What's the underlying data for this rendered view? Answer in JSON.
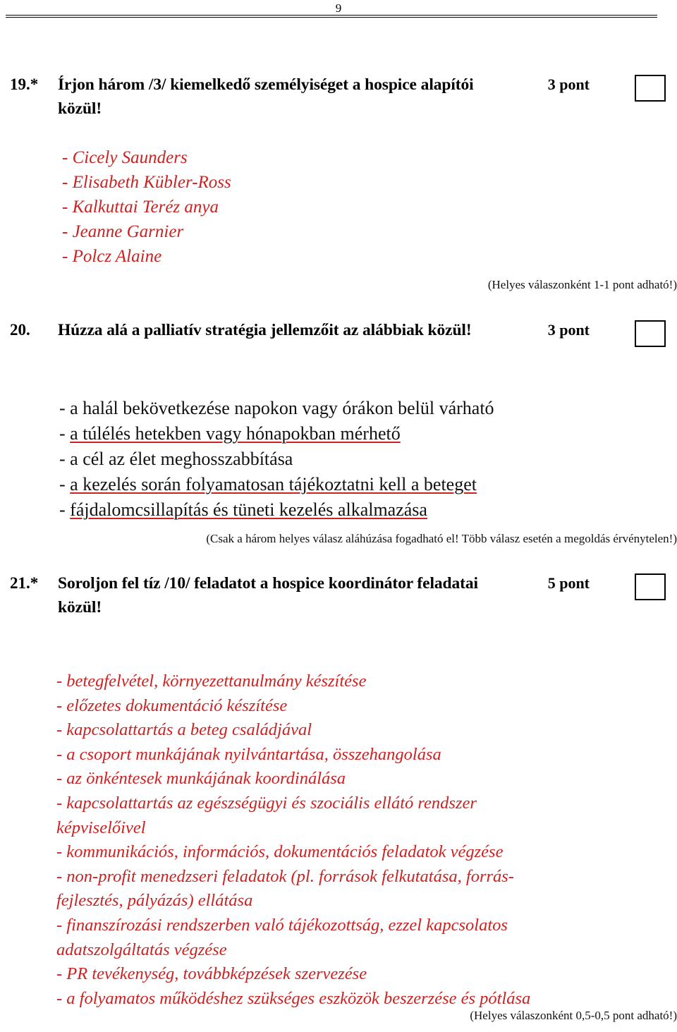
{
  "page": {
    "number": "9"
  },
  "questions": [
    {
      "id": "q19",
      "number": "19.*",
      "title": "Írjon három /3/ kiemelkedő személyiséget a hospice alapítói közül!",
      "points": "3 pont",
      "score_box_value": "",
      "answers": [
        "- Cicely Saunders",
        "- Elisabeth Kübler-Ross",
        "- Kalkuttai Teréz anya",
        "- Jeanne Garnier",
        "- Polcz Alaine"
      ],
      "note": "(Helyes válaszonként 1-1 pont adható!)"
    },
    {
      "id": "q20",
      "number": "20.",
      "title": "Húzza alá a palliatív stratégia jellemzőit az alábbiak közül!",
      "points": "3 pont",
      "score_box_value": "",
      "options": [
        {
          "text": "a halál bekövetkezése napokon vagy órákon belül várható",
          "underlined": false
        },
        {
          "text": "a túlélés hetekben vagy hónapokban mérhető",
          "underlined": true
        },
        {
          "text": "a cél az élet meghosszabbítása",
          "underlined": false
        },
        {
          "text": "a kezelés során folyamatosan tájékoztatni kell a beteget",
          "underlined": true
        },
        {
          "text": "fájdalomcsillapítás és tüneti kezelés alkalmazása",
          "underlined": true
        }
      ],
      "note": "(Csak a három helyes válasz aláhúzása fogadható el! Több válasz esetén a megoldás érvénytelen!)"
    },
    {
      "id": "q21",
      "number": "21.*",
      "title": "Soroljon fel tíz /10/ feladatot a hospice koordinátor feladatai közül!",
      "points": "5 pont",
      "score_box_value": "",
      "answers": [
        "- betegfelvétel, környezettanulmány készítése",
        "- előzetes dokumentáció készítése",
        "- kapcsolattartás a beteg családjával",
        "- a csoport munkájának nyilvántartása, összehangolása",
        "- az önkéntesek munkájának koordinálása",
        "- kapcsolattartás az egészségügyi és szociális ellátó rendszer",
        "képviselőivel",
        "- kommunikációs, információs, dokumentációs feladatok végzése",
        "- non-profit menedzseri feladatok (pl. források felkutatása, forrás-",
        "fejlesztés, pályázás) ellátása",
        "- finanszírozási rendszerben való tájékozottság, ezzel kapcsolatos",
        "adatszolgáltatás végzése",
        "- PR tevékenység, továbbképzések szervezése",
        "- a folyamatos működéshez szükséges eszközök beszerzése és pótlása"
      ],
      "continuation_indices": [
        6,
        9,
        11
      ],
      "note": "(Helyes válaszonként 0,5-0,5 pont adható!)"
    }
  ],
  "colors": {
    "answer_red": "#cc2222",
    "text_black": "#111111",
    "underline_red": "#cc2222"
  },
  "dash_prefix": "- "
}
